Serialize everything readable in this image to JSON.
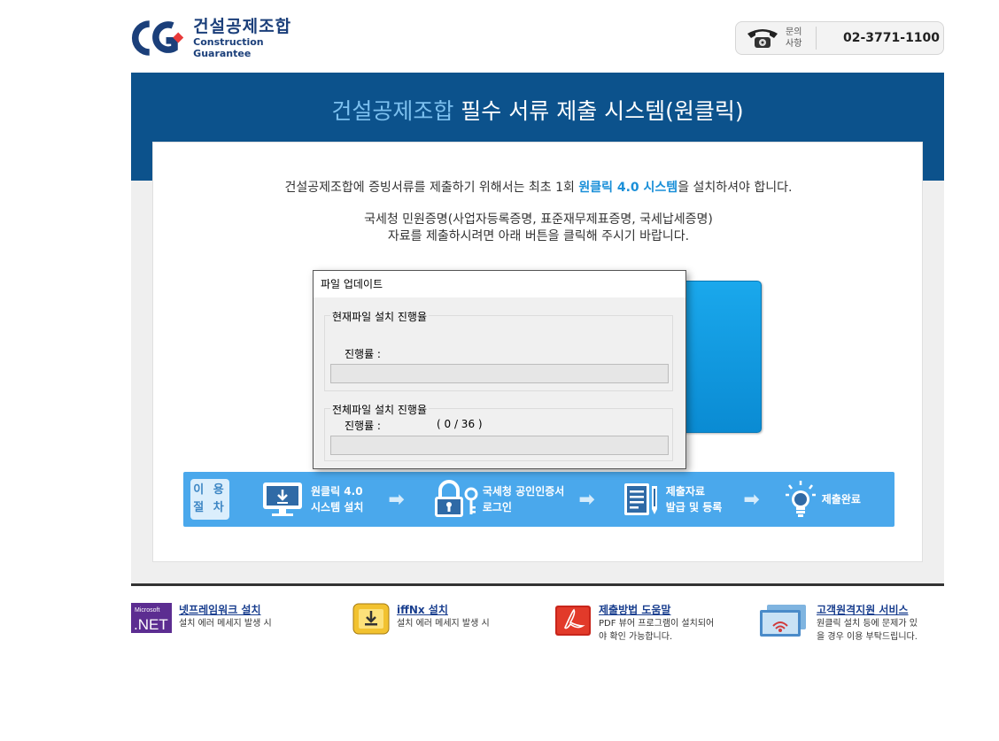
{
  "header": {
    "logo_ko": "건설공제조합",
    "logo_en": "Construction Guarantee",
    "contact_label_1": "문의",
    "contact_label_2": "사항",
    "contact_number": "02-3771-1100"
  },
  "band": {
    "title_accent": "건설공제조합",
    "title_rest": " 필수 서류 제출 시스템(원클릭)"
  },
  "intro": {
    "line1_before": "건설공제조합에 증빙서류를 제출하기 위해서는 최초 1회 ",
    "line1_bold": "원클릭 4.0 시스템",
    "line1_after": "을 설치하셔야 합니다.",
    "line2": "국세청 민원증명(사업자등록증명, 표준재무제표증명, 국세납세증명)",
    "line3": "자료를 제출하시려면 아래 버튼을 클릭해 주시기 바랍니다."
  },
  "steps": {
    "badge_1": "이 용",
    "badge_2": "절 차",
    "items": [
      {
        "line1": "원클릭 4.0",
        "line2": "시스템 설치",
        "icon": "monitor-download-icon"
      },
      {
        "line1": "국세청 공인인증서",
        "line2": "로그인",
        "icon": "lock-key-icon"
      },
      {
        "line1": "제출자료",
        "line2": "발급 및 등록",
        "icon": "document-pen-icon"
      },
      {
        "line1": "제출완료",
        "line2": "",
        "icon": "lightbulb-icon"
      }
    ],
    "arrow": "➡"
  },
  "dialog": {
    "title": "파일 업데이트",
    "current": {
      "legend": "현재파일 설치 진행율",
      "label": "진행률 :",
      "count": "",
      "progress": 0
    },
    "total": {
      "legend": "전체파일 설치 진행율",
      "label": "진행률 :",
      "count": "( 0 / 36 )",
      "progress": 0
    }
  },
  "footer": [
    {
      "title": "넷프레임워크 설치",
      "desc1": "설치 에러 메세지 발생 시",
      "desc2": "",
      "icon": "dotnet-icon"
    },
    {
      "title": "iffNx 설치",
      "desc1": "설치 에러 메세지 발생 시",
      "desc2": "",
      "icon": "download-box-icon"
    },
    {
      "title": "제출방법 도움말",
      "desc1": "PDF 뷰어 프로그램이 설치되어",
      "desc2": "야 확인 가능합니다.",
      "icon": "pdf-icon"
    },
    {
      "title": "고객원격지원 서비스",
      "desc1": "원클릭 설치 등에 문제가 있",
      "desc2": "을 경우 이용 부탁드립니다.",
      "icon": "remote-support-icon"
    }
  ],
  "colors": {
    "band": "#0c528c",
    "accent": "#7cc0ef",
    "steps_bar": "#4aa8ec",
    "link": "#1a3f8f"
  }
}
